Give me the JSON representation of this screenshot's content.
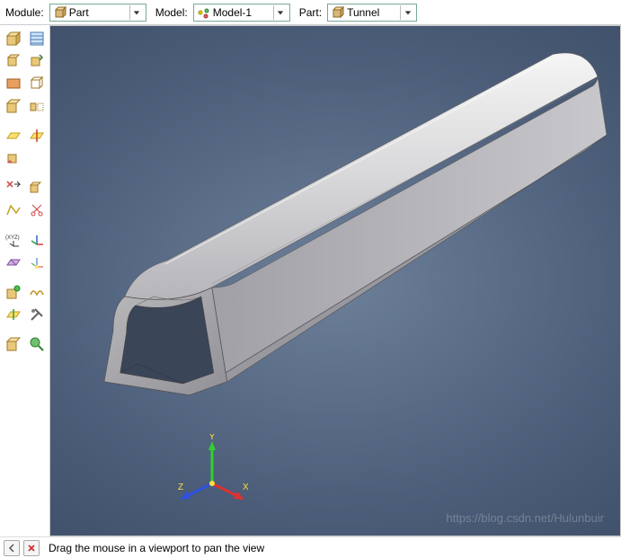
{
  "topbar": {
    "module_label": "Module:",
    "module_value": "Part",
    "model_label": "Model:",
    "model_value": "Model-1",
    "part_label": "Part:",
    "part_value": "Tunnel"
  },
  "toolbox": {
    "groups": [
      [
        "create-part-icon",
        "part-manager-icon"
      ],
      [
        "create-shell-icon",
        "create-solid-icon"
      ],
      [
        "create-cut-icon",
        "create-round-icon"
      ],
      [
        "create-wire-icon",
        "create-sweep-icon"
      ]
    ]
  },
  "triad": {
    "x": "X",
    "y": "Y",
    "z": "Z"
  },
  "status": {
    "text": "Drag the mouse in a viewport to pan the view"
  },
  "watermark": "https://blog.csdn.net/Hulunbuir"
}
